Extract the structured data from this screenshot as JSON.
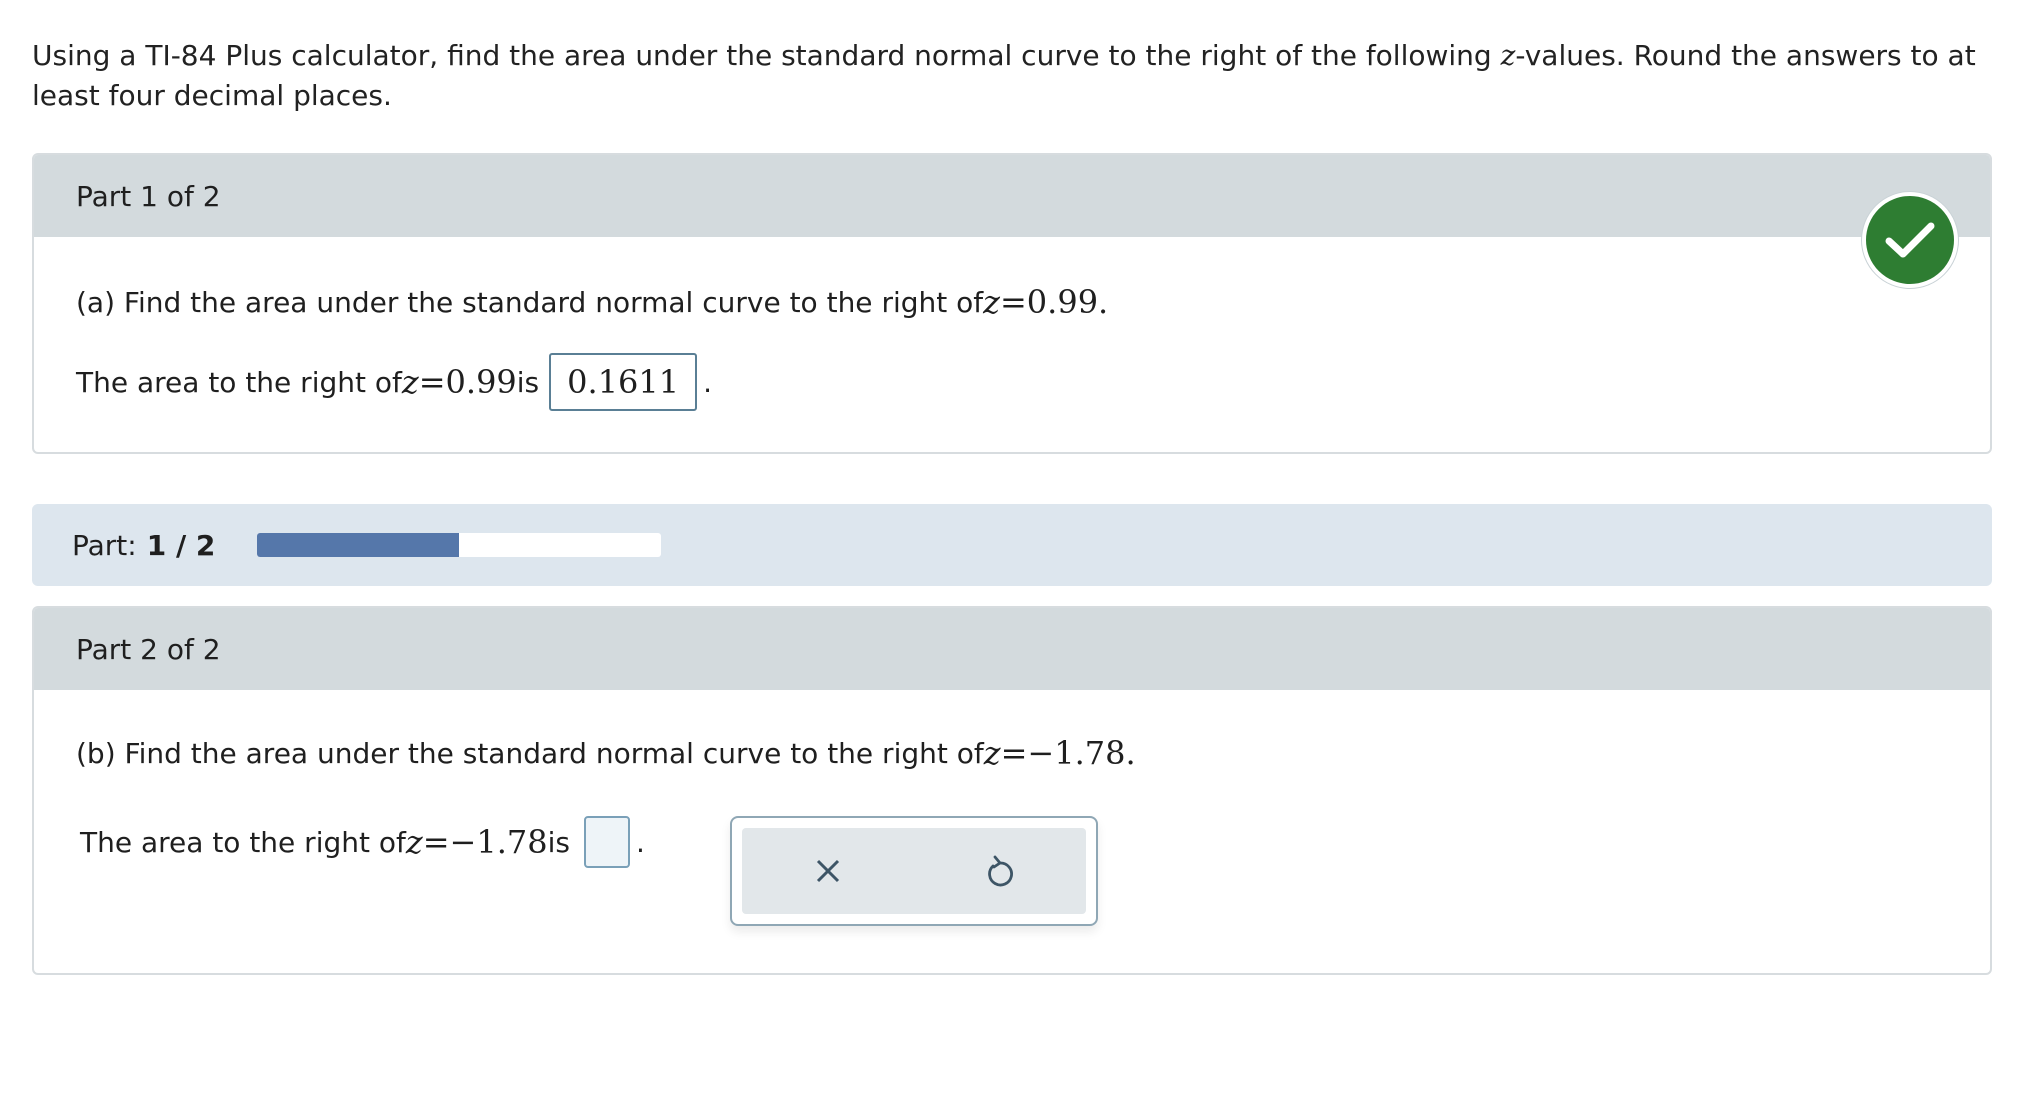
{
  "prompt": {
    "text_before": "Using a TI-84 Plus calculator, find the area under the standard normal curve to the right of the following ",
    "var": "z",
    "text_after": "-values. Round the answers to at least four decimal places."
  },
  "part1": {
    "header": "Part 1 of 2",
    "question_prefix": "(a) Find the area under the standard normal curve to the right of ",
    "question_var": "z",
    "question_eq": "=0.99",
    "question_suffix": ".",
    "answer_prefix": "The area to the right of ",
    "answer_var": "z",
    "answer_eq": "=0.99",
    "answer_is": " is",
    "answer_value": "0.1611",
    "answer_suffix": ".",
    "status_icon": "check-icon",
    "status_color": "#2e7d32"
  },
  "progress": {
    "label": "Part:",
    "value_text": "1 / 2",
    "fraction": 0.5,
    "fill_color": "#5577aa"
  },
  "part2": {
    "header": "Part 2 of 2",
    "question_prefix": "(b) Find the area under the standard normal curve to the right of ",
    "question_var": "z",
    "question_eq": "=−1.78",
    "question_suffix": ".",
    "answer_prefix": "The area to the right of ",
    "answer_var": "z",
    "answer_eq": "=−1.78",
    "answer_is": " is",
    "answer_value": "",
    "answer_suffix": "."
  },
  "toolbox": {
    "clear_icon": "close-icon",
    "undo_icon": "undo-icon"
  }
}
